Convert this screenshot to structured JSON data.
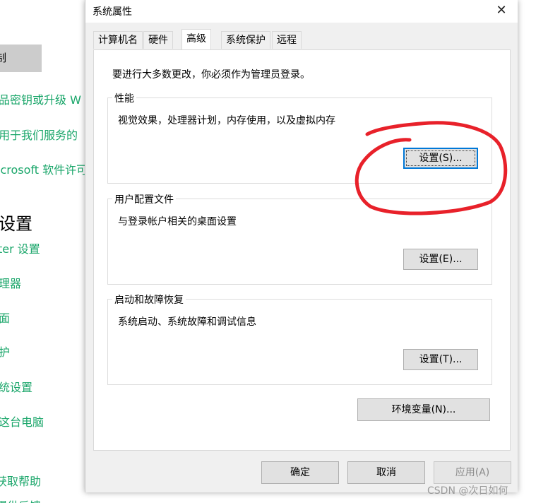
{
  "background": {
    "button_label": "制",
    "links": [
      "品密钥或升级 W",
      "用于我们服务的",
      "icrosoft 软件许可",
      "ter 设置",
      "理器",
      "面",
      "护",
      "统设置",
      "这台电脑",
      "获取帮助",
      "提供反馈"
    ],
    "heading": "设置"
  },
  "dialog": {
    "title": "系统属性",
    "close_glyph": "✕",
    "tabs": [
      {
        "label": "计算机名"
      },
      {
        "label": "硬件"
      },
      {
        "label": "高级"
      },
      {
        "label": "系统保护"
      },
      {
        "label": "远程"
      }
    ],
    "active_tab": "高级",
    "notice": "要进行大多数更改，你必须作为管理员登录。",
    "performance": {
      "label": "性能",
      "description": "视觉效果，处理器计划，内存使用，以及虚拟内存",
      "button": "设置(S)..."
    },
    "user_profiles": {
      "label": "用户配置文件",
      "description": "与登录帐户相关的桌面设置",
      "button": "设置(E)..."
    },
    "startup_recovery": {
      "label": "启动和故障恢复",
      "description": "系统启动、系统故障和调试信息",
      "button": "设置(T)..."
    },
    "env_button": "环境变量(N)...",
    "footer": {
      "ok": "确定",
      "cancel": "取消",
      "apply": "应用(A)"
    }
  },
  "annotation_color": "#e8212a",
  "watermark": "CSDN @次日如何"
}
